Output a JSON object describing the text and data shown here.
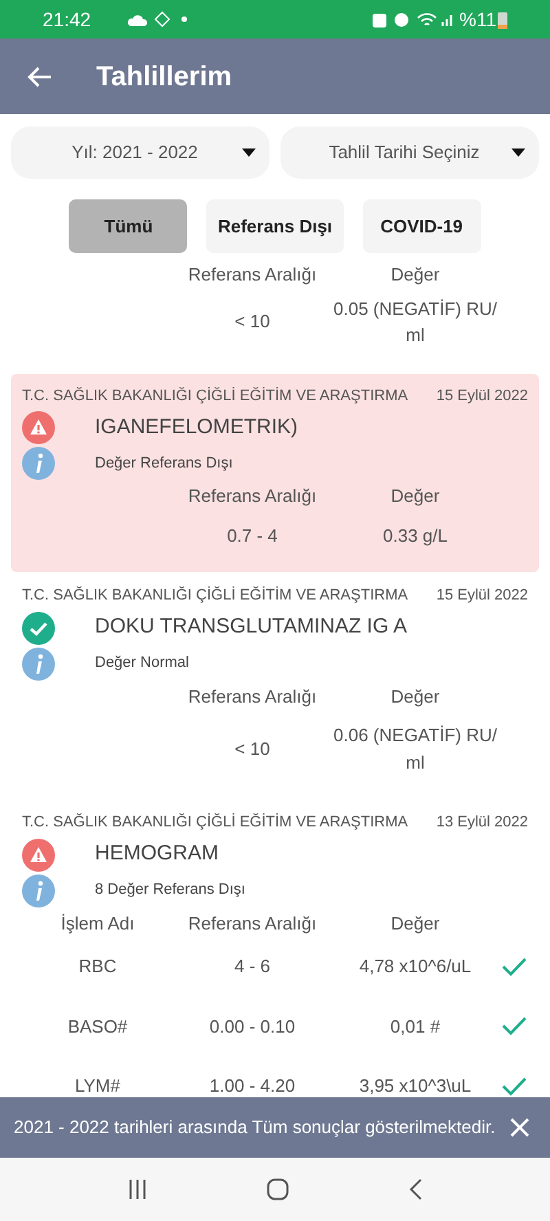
{
  "status_bar": {
    "time": "21:42",
    "battery": "%11"
  },
  "header": {
    "title": "Tahlillerim"
  },
  "dropdowns": [
    {
      "label": "Yıl: 2021 - 2022"
    },
    {
      "label": "Tahlil Tarihi Seçiniz"
    }
  ],
  "filters": [
    {
      "label": "Tümü",
      "selected": true
    },
    {
      "label": "Referans Dışı",
      "selected": false
    },
    {
      "label": "COVID-19",
      "selected": false
    }
  ],
  "results": [
    {
      "columns": [
        "Referans Aralığı",
        "Değer"
      ],
      "rows": [
        {
          "cells": [
            "< 10",
            "0.05 (NEGATİF) RU/ ml"
          ]
        }
      ]
    },
    {
      "lab": "T.C. SAĞLIK BAKANLIĞI ÇİĞLİ EĞİTİM VE ARAŞTIRMA",
      "date": "15 Eylül 2022",
      "name": "IGANEFELOMETRIK)",
      "kind": "abnormal",
      "highlighted": true,
      "note": "Değer Referans Dışı",
      "columns": [
        "Referans Aralığı",
        "Değer"
      ],
      "rows": [
        {
          "cells": [
            "0.7 - 4",
            "0.33 g/L"
          ]
        }
      ]
    },
    {
      "lab": "T.C. SAĞLIK BAKANLIĞI ÇİĞLİ EĞİTİM VE ARAŞTIRMA",
      "date": "15 Eylül 2022",
      "name": "DOKU TRANSGLUTAMINAZ IG A",
      "kind": "normal",
      "highlighted": false,
      "note": "Değer Normal",
      "columns": [
        "Referans Aralığı",
        "Değer"
      ],
      "rows": [
        {
          "cells": [
            "< 10",
            "0.06 (NEGATİF) RU/ ml"
          ]
        }
      ]
    },
    {
      "lab": "T.C. SAĞLIK BAKANLIĞI ÇİĞLİ EĞİTİM VE ARAŞTIRMA",
      "date": "13 Eylül 2022",
      "name": "HEMOGRAM",
      "kind": "abnormal",
      "highlighted": false,
      "note": "8 Değer Referans Dışı",
      "columns": [
        "İşlem Adı",
        "Referans Aralığı",
        "Değer"
      ],
      "rows": [
        {
          "cells": [
            "RBC",
            "4 - 6",
            "4,78 x10^6/uL"
          ],
          "ok": true
        },
        {
          "cells": [
            "BASO#",
            "0.00 - 0.10",
            "0,01 #"
          ],
          "ok": true
        },
        {
          "cells": [
            "LYM#",
            "1.00 - 4.20",
            "3,95 x10^3\\uL"
          ],
          "ok": true
        }
      ]
    }
  ],
  "snackbar": {
    "message": "2021 - 2022 tarihleri arasında Tüm sonuçlar gösterilmektedir."
  }
}
